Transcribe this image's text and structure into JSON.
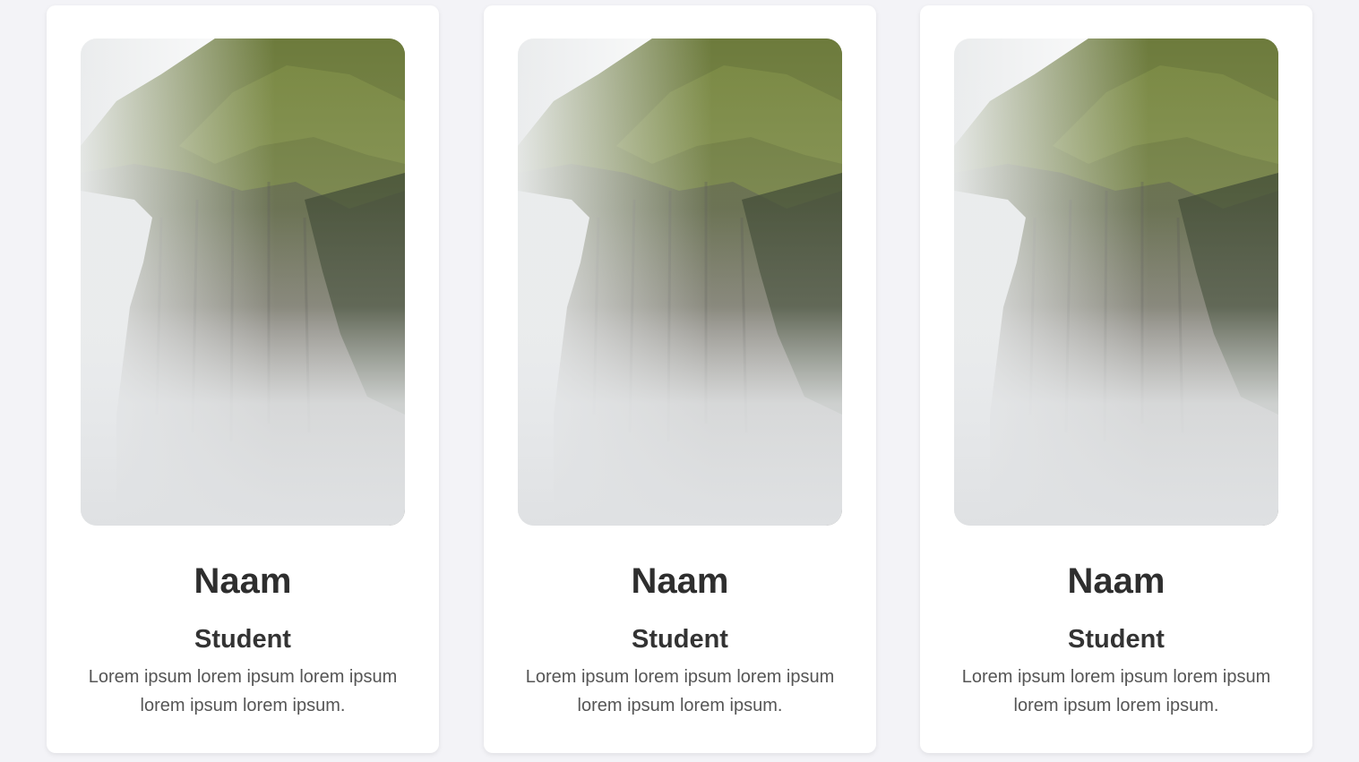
{
  "cards": [
    {
      "name": "Naam",
      "role": "Student",
      "description": "Lorem ipsum lorem ipsum lorem ipsum lorem ipsum lorem ipsum.",
      "photo_icon": "mountain-cliff-fog-photo"
    },
    {
      "name": "Naam",
      "role": "Student",
      "description": "Lorem ipsum lorem ipsum lorem ipsum lorem ipsum lorem ipsum.",
      "photo_icon": "mountain-cliff-fog-photo"
    },
    {
      "name": "Naam",
      "role": "Student",
      "description": "Lorem ipsum lorem ipsum lorem ipsum lorem ipsum lorem ipsum.",
      "photo_icon": "mountain-cliff-fog-photo"
    }
  ],
  "colors": {
    "page_background": "#f3f3f7",
    "card_background": "#ffffff",
    "name_text": "#2e2e2e",
    "description_text": "#555555"
  }
}
